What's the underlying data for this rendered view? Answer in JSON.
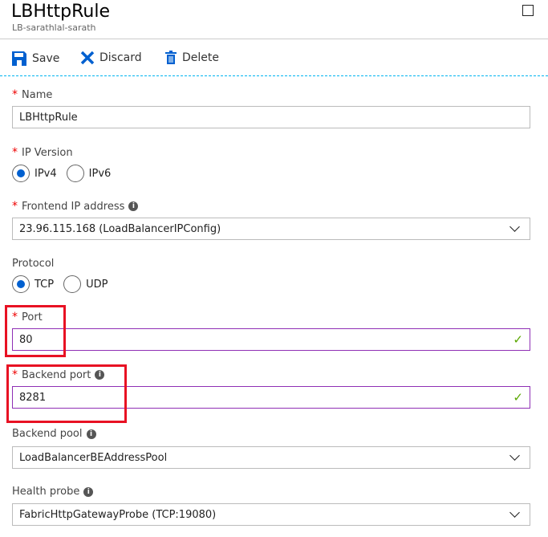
{
  "header": {
    "title": "LBHttpRule",
    "subtitle": "LB-sarathlal-sarath"
  },
  "toolbar": {
    "save": "Save",
    "discard": "Discard",
    "delete": "Delete"
  },
  "form": {
    "name": {
      "label": "Name",
      "value": "LBHttpRule"
    },
    "ip_version": {
      "label": "IP Version",
      "options": [
        "IPv4",
        "IPv6"
      ],
      "selected": "IPv4"
    },
    "frontend_ip": {
      "label": "Frontend IP address",
      "value": "23.96.115.168 (LoadBalancerIPConfig)"
    },
    "protocol": {
      "label": "Protocol",
      "options": [
        "TCP",
        "UDP"
      ],
      "selected": "TCP"
    },
    "port": {
      "label": "Port",
      "value": "80"
    },
    "backend_port": {
      "label": "Backend port",
      "value": "8281"
    },
    "backend_pool": {
      "label": "Backend pool",
      "value": "LoadBalancerBEAddressPool"
    },
    "health_probe": {
      "label": "Health probe",
      "value": "FabricHttpGatewayProbe (TCP:19080)"
    }
  },
  "colors": {
    "accent": "#0060d0",
    "valid_border": "#8f2fb5",
    "highlight": "#e81123"
  }
}
